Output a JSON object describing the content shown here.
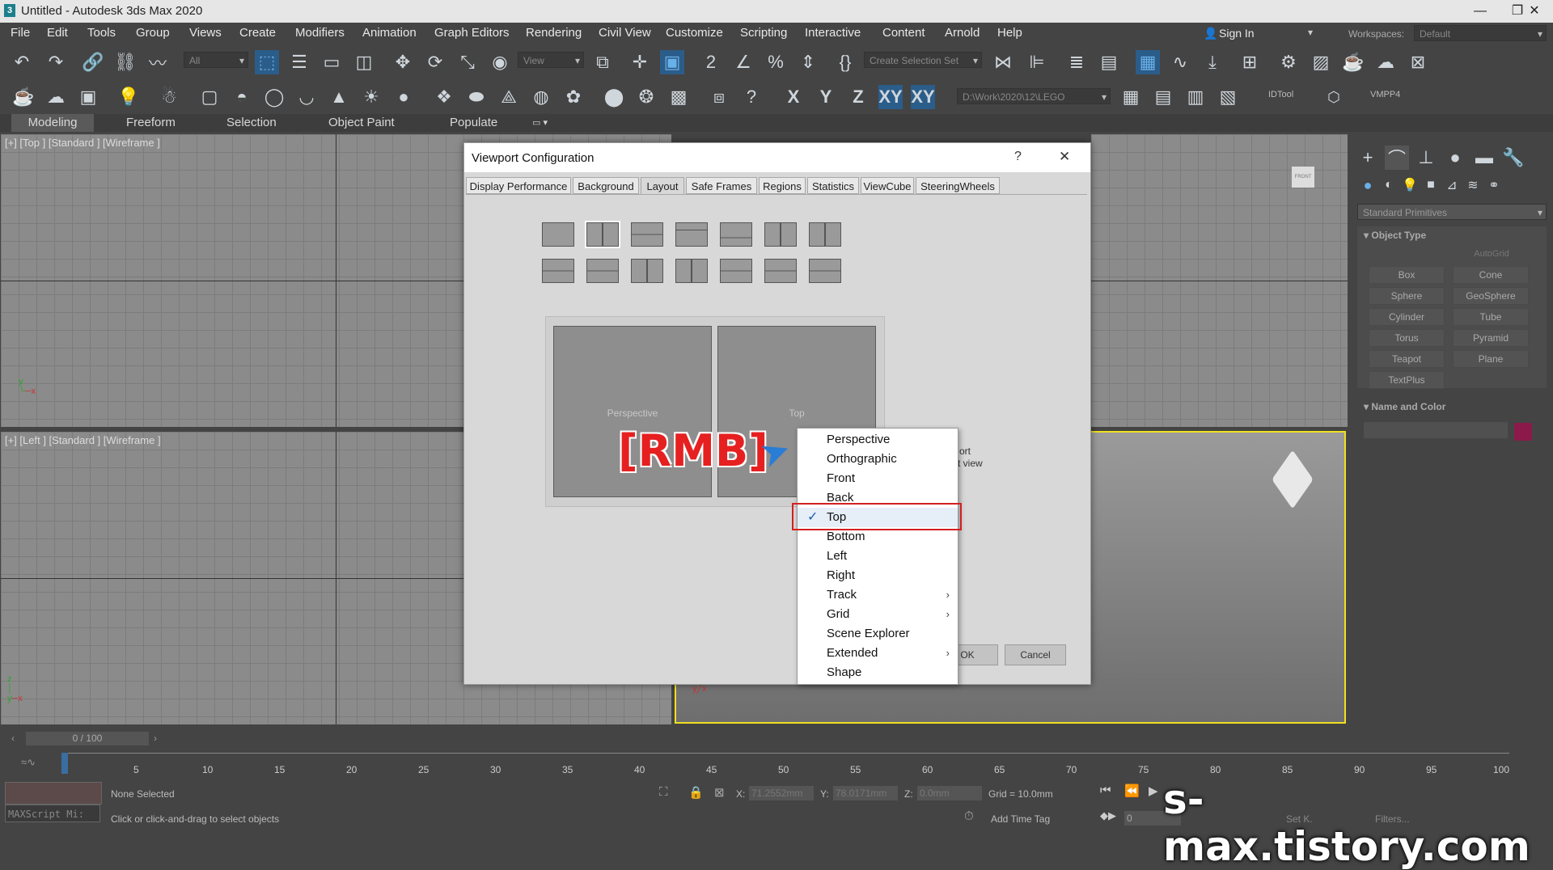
{
  "window": {
    "title": "Untitled - Autodesk 3ds Max 2020",
    "minimize": "—",
    "restore": "❐",
    "close": "✕",
    "logo": "3"
  },
  "menu": [
    "File",
    "Edit",
    "Tools",
    "Group",
    "Views",
    "Create",
    "Modifiers",
    "Animation",
    "Graph Editors",
    "Rendering",
    "Civil View",
    "Customize",
    "Scripting",
    "Interactive",
    "Content",
    "Arnold",
    "Help"
  ],
  "account": {
    "sign_in": "Sign In",
    "workspaces_label": "Workspaces:",
    "workspace_value": "Default"
  },
  "toolbar": {
    "selection_filter": "All",
    "ref_coord": "View",
    "named_selection": "Create Selection Set",
    "axis_x": "X",
    "axis_y": "Y",
    "axis_z": "Z",
    "axis_xy": "XY",
    "axis_xy2": "XY",
    "project_path": "D:\\Work\\2020\\12\\LEGO",
    "idtool": "IDTool",
    "vmpp4": "VMPP4"
  },
  "ribbon_tabs": [
    "Modeling",
    "Freeform",
    "Selection",
    "Object Paint",
    "Populate"
  ],
  "viewports": {
    "top_label": "[+] [Top ] [Standard ] [Wireframe ]",
    "left_label": "[+] [Left ] [Standard ] [Wireframe ]",
    "viewcube_front": "FRONT"
  },
  "command_panel": {
    "category": "Standard Primitives",
    "object_type_header": "Object Type",
    "autogrid": "AutoGrid",
    "buttons": [
      "Box",
      "Cone",
      "Sphere",
      "GeoSphere",
      "Cylinder",
      "Tube",
      "Torus",
      "Pyramid",
      "Teapot",
      "Plane",
      "TextPlus"
    ],
    "name_color_header": "Name and Color",
    "color": "#8b1a4a"
  },
  "dialog": {
    "title": "Viewport Configuration",
    "help": "?",
    "close": "✕",
    "tabs": [
      "Display Performance",
      "Background",
      "Layout",
      "Safe Frames",
      "Regions",
      "Statistics",
      "ViewCube",
      "SteeringWheels"
    ],
    "active_tab": "Layout",
    "pane_left": "Perspective",
    "pane_right": "Top",
    "side_text_1": "ort",
    "side_text_2": "ct view",
    "ok": "OK",
    "cancel": "Cancel"
  },
  "annotation": {
    "rmb": "[RMB]",
    "highlight_color": "#d42020"
  },
  "context_menu": {
    "items": [
      {
        "label": "Perspective",
        "submenu": false,
        "checked": false
      },
      {
        "label": "Orthographic",
        "submenu": false,
        "checked": false
      },
      {
        "label": "Front",
        "submenu": false,
        "checked": false
      },
      {
        "label": "Back",
        "submenu": false,
        "checked": false
      },
      {
        "label": "Top",
        "submenu": false,
        "checked": true
      },
      {
        "label": "Bottom",
        "submenu": false,
        "checked": false
      },
      {
        "label": "Left",
        "submenu": false,
        "checked": false
      },
      {
        "label": "Right",
        "submenu": false,
        "checked": false
      },
      {
        "label": "Track",
        "submenu": true,
        "checked": false
      },
      {
        "label": "Grid",
        "submenu": true,
        "checked": false
      },
      {
        "label": "Scene Explorer",
        "submenu": false,
        "checked": false
      },
      {
        "label": "Extended",
        "submenu": true,
        "checked": false
      },
      {
        "label": "Shape",
        "submenu": false,
        "checked": false
      }
    ],
    "check_glyph": "✓",
    "arrow_glyph": "›"
  },
  "timeline": {
    "frame": "0 / 100",
    "ticks": [
      "5",
      "10",
      "15",
      "20",
      "25",
      "30",
      "35",
      "40",
      "45",
      "50",
      "55",
      "60",
      "65",
      "70",
      "75",
      "80",
      "85",
      "90",
      "95",
      "100"
    ]
  },
  "status": {
    "selection": "None Selected",
    "prompt": "Click or click-and-drag to select objects",
    "maxscript": "MAXScript Mi:",
    "x_label": "X:",
    "x_value": "71.2552mm",
    "y_label": "Y:",
    "y_value": "78.0171mm",
    "z_label": "Z:",
    "z_value": "0.0mm",
    "grid": "Grid = 10.0mm",
    "add_time_tag": "Add Time Tag",
    "frame_field": "0",
    "set_key": "Set K.",
    "filters": "Filters..."
  },
  "watermark": "s-max.tistory.com"
}
